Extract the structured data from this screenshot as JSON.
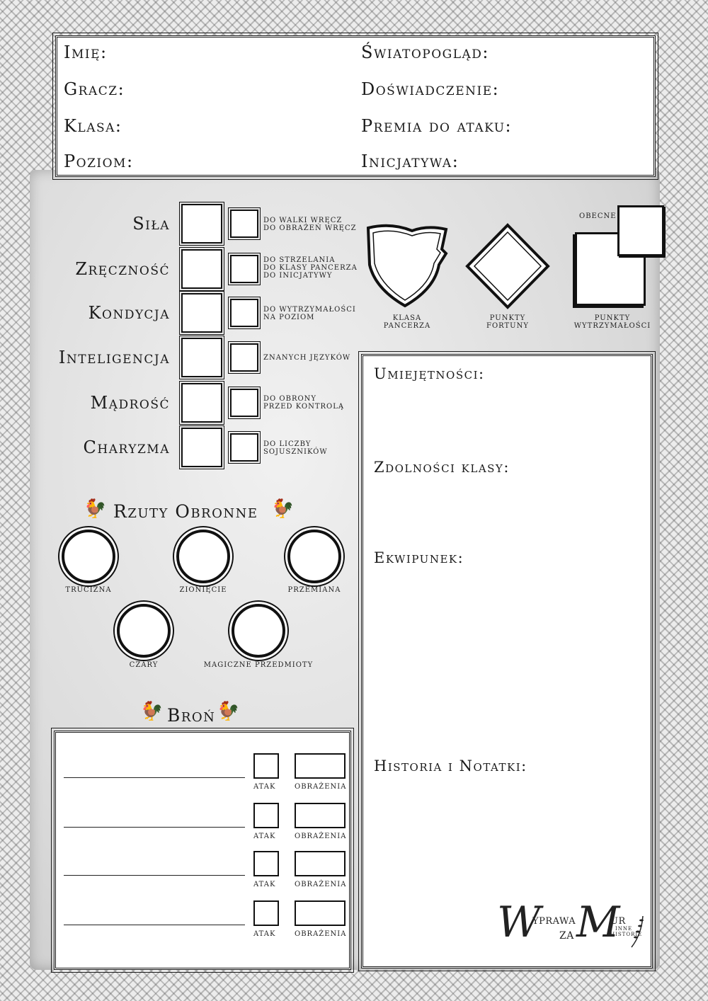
{
  "header": {
    "name_label": "Imię:",
    "player_label": "Gracz:",
    "class_label": "Klasa:",
    "level_label": "Poziom:",
    "alignment_label": "Światopogląd:",
    "experience_label": "Doświadczenie:",
    "attack_bonus_label": "Premia do ataku:",
    "initiative_label": "Inicjatywa:"
  },
  "attributes": [
    {
      "name": "Siła",
      "note1": "do walki wręcz",
      "note2": "do obrażeń wręcz",
      "note3": ""
    },
    {
      "name": "Zręczność",
      "note1": "do strzelania",
      "note2": "do klasy pancerza",
      "note3": "do inicjatywy"
    },
    {
      "name": "Kondycja",
      "note1": "do wytrzymałości",
      "note2": "na poziom",
      "note3": ""
    },
    {
      "name": "Inteligencja",
      "note1": "znanych języków",
      "note2": "",
      "note3": ""
    },
    {
      "name": "Mądrość",
      "note1": "do obrony",
      "note2": "przed kontrolą",
      "note3": ""
    },
    {
      "name": "Charyzma",
      "note1": "do liczby",
      "note2": "sojuszników",
      "note3": ""
    }
  ],
  "combat": {
    "armor_class": {
      "line1": "Klasa",
      "line2": "pancerza"
    },
    "fortune_points": {
      "line1": "Punkty",
      "line2": "fortuny"
    },
    "hit_points": {
      "line1": "Punkty",
      "line2": "wytrzymałości"
    },
    "current_label": "Obecne"
  },
  "saves": {
    "title": "Rzuty Obronne",
    "poison": "Trucizna",
    "breath": "Zionięcie",
    "transformation": "Przemiana",
    "spells": "Czary",
    "magic_items": "Magiczne przedmioty"
  },
  "weapons": {
    "title": "Broń",
    "attack_label": "Atak",
    "damage_label": "Obrażenia"
  },
  "notes": {
    "skills": "Umiejętności:",
    "class_abilities": "Zdolności klasy:",
    "equipment": "Ekwipunek:",
    "history": "Historia i Notatki:"
  },
  "logo": {
    "w": "W",
    "yprawa": "YPRAWA",
    "za": "ZA",
    "m": "M",
    "ur": "UR",
    "inne": "I INNE",
    "historie": "HISTORIE"
  },
  "icons": {
    "bird": "rooster-icon"
  }
}
